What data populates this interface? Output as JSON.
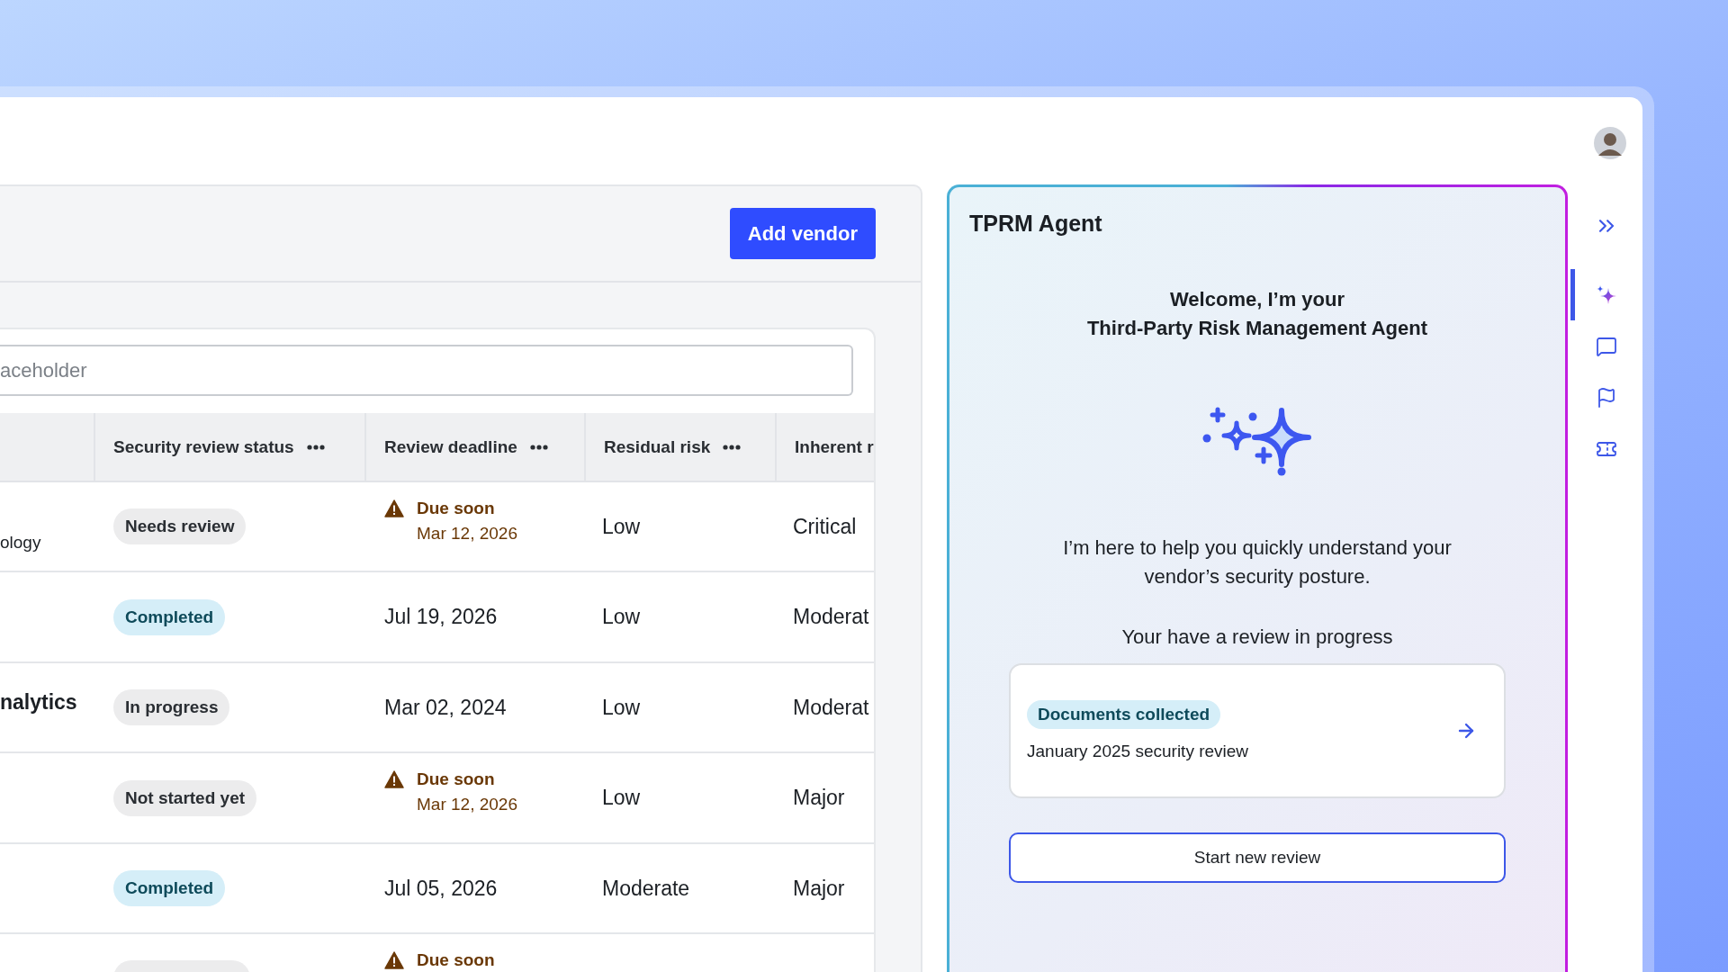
{
  "toolbar": {
    "add_button": "Add vendor"
  },
  "search": {
    "placeholder": "aceholder"
  },
  "table": {
    "columns": [
      {
        "label": "Security review status",
        "has_menu": true
      },
      {
        "label": "Review deadline",
        "has_menu": true
      },
      {
        "label": "Residual risk",
        "has_menu": true
      },
      {
        "label": "Inherent r",
        "has_menu": false
      }
    ],
    "rows": [
      {
        "name": {
          "text": "ology",
          "kind": "subtitle"
        },
        "status": {
          "label": "Needs review",
          "kind": "neutral"
        },
        "deadline": {
          "due_soon": true,
          "label": "Due soon",
          "date": "Mar 12, 2026"
        },
        "residual": "Low",
        "inherent": "Critical"
      },
      {
        "status": {
          "label": "Completed",
          "kind": "done"
        },
        "deadline": {
          "due_soon": false,
          "date": "Jul 19, 2026"
        },
        "residual": "Low",
        "inherent": "Moderat"
      },
      {
        "name": {
          "text": "nalytics",
          "kind": "title"
        },
        "status": {
          "label": "In progress",
          "kind": "neutral"
        },
        "deadline": {
          "due_soon": false,
          "date": "Mar 02, 2024"
        },
        "residual": "Low",
        "inherent": "Moderat"
      },
      {
        "status": {
          "label": "Not started yet",
          "kind": "neutral"
        },
        "deadline": {
          "due_soon": true,
          "label": "Due soon",
          "date": "Mar 12, 2026"
        },
        "residual": "Low",
        "inherent": "Major"
      },
      {
        "status": {
          "label": "Completed",
          "kind": "done"
        },
        "deadline": {
          "due_soon": false,
          "date": "Jul 05, 2026"
        },
        "residual": "Moderate",
        "inherent": "Major"
      },
      {
        "status": {
          "kind": "neutral"
        },
        "deadline": {
          "due_soon": true,
          "label": "Due soon"
        }
      }
    ]
  },
  "agent": {
    "title": "TPRM Agent",
    "welcome": [
      "Welcome, I’m your",
      "Third-Party Risk Management Agent"
    ],
    "intro": "I’m here to help you quickly understand your vendor’s security posture.",
    "progress_heading": "Your have a review in progress",
    "review_card": {
      "status": "Documents collected",
      "title": "January 2025 security review"
    },
    "start_button": "Start new review"
  },
  "rail": {
    "items": [
      {
        "kind": "sparkle",
        "selected": true
      },
      {
        "kind": "chat",
        "selected": false
      },
      {
        "kind": "flag",
        "selected": false
      },
      {
        "kind": "ticket",
        "selected": false
      }
    ]
  }
}
